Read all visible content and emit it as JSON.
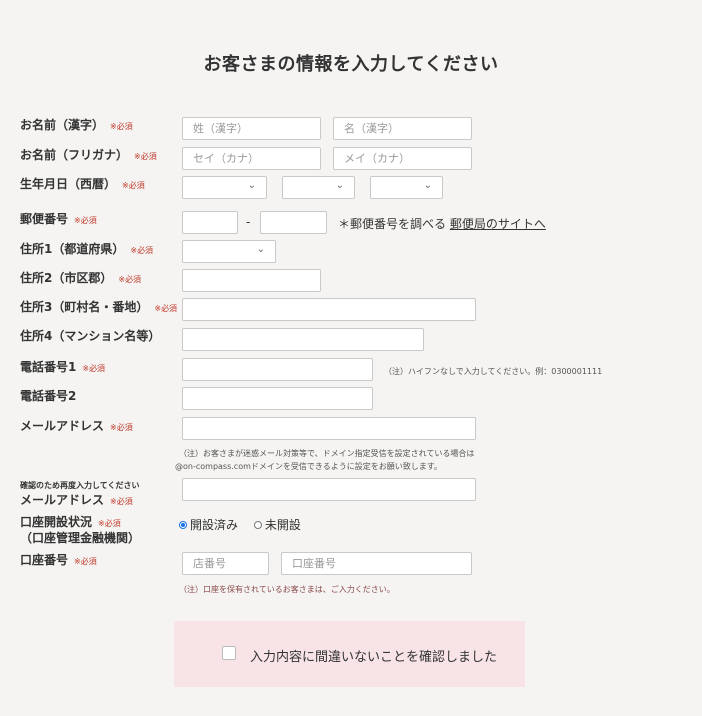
{
  "page": {
    "title": "お客さまの情報を入力してください"
  },
  "required_mark": "※必須",
  "name_kanji": {
    "label": "お名前（漢字）",
    "last_placeholder": "姓（漢字）",
    "first_placeholder": "名（漢字）"
  },
  "name_kana": {
    "label": "お名前（フリガナ）",
    "last_placeholder": "セイ（カナ）",
    "first_placeholder": "メイ（カナ）"
  },
  "birthdate": {
    "label": "生年月日（西暦）"
  },
  "zip": {
    "label": "郵便番号",
    "dash": "-",
    "lookup_text": "＊郵便番号を調べる",
    "lookup_link": "郵便局のサイトへ"
  },
  "address1": {
    "label": "住所1（都道府県）"
  },
  "address2": {
    "label": "住所2（市区郡）"
  },
  "address3": {
    "label": "住所3（町村名・番地）"
  },
  "address4": {
    "label": "住所4（マンション名等）"
  },
  "phone1": {
    "label": "電話番号1",
    "note": "（注）ハイフンなしで入力してください。例：0300001111"
  },
  "phone2": {
    "label": "電話番号2"
  },
  "email": {
    "label": "メールアドレス",
    "note_line1": "（注）お客さまが迷惑メール対策等で、ドメイン指定受信を設定されている場合は",
    "note_line2": "@on-compass.comドメインを受信できるように設定をお願い致します。"
  },
  "email_confirm": {
    "sub_label": "確認のため再度入力してください",
    "label": "メールアドレス"
  },
  "account_status": {
    "label_line1": "口座開設状況",
    "label_line2": "（口座管理金融機関）",
    "options": [
      "開設済み",
      "未開設"
    ],
    "selected": "開設済み"
  },
  "account_number": {
    "label": "口座番号",
    "branch_placeholder": "店番号",
    "number_placeholder": "口座番号",
    "note": "（注）口座を保有されているお客さまは、ご入力ください。"
  },
  "confirm": {
    "text": "入力内容に間違いないことを確認しました",
    "checked": false
  },
  "icons": {
    "select": "chevron-down-icon",
    "checkbox": "checkbox-icon"
  },
  "colors": {
    "background": "#f5f4f2",
    "required": "#c0392b",
    "confirm_bg": "#f8e4e6",
    "radio_accent": "#1a73e8"
  }
}
